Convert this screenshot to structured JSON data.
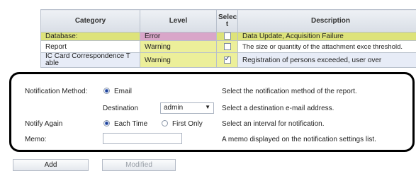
{
  "table": {
    "headers": {
      "category": "Category",
      "level": "Level",
      "select": "Selec t",
      "description": "Description"
    },
    "rows": [
      {
        "category": "Database:",
        "level": "Error",
        "checked": false,
        "description": "Data Update, Acquisition Failure"
      },
      {
        "category": "Report",
        "level": "Warning",
        "checked": false,
        "description": "The size or quantity of the attachment exce threshold."
      },
      {
        "category": "IC Card Correspondence T able",
        "level": "Warning",
        "checked": true,
        "description": "Registration of persons exceeded, user over"
      }
    ]
  },
  "notification": {
    "method_label": "Notification Method:",
    "method_value": "Email",
    "method_help": "Select the notification method of the report.",
    "destination_label": "Destination",
    "destination_value": "admin",
    "destination_help": "Select a destination e-mail address.",
    "notify_again_label": "Notify Again",
    "option_each_time": "Each Time",
    "option_first_only": "First Only",
    "notify_again_help": "Select an interval for notification.",
    "memo_label": "Memo:",
    "memo_value": "",
    "memo_help": "A memo displayed on the notification settings list."
  },
  "buttons": {
    "add": "Add",
    "modified": "Modified"
  }
}
